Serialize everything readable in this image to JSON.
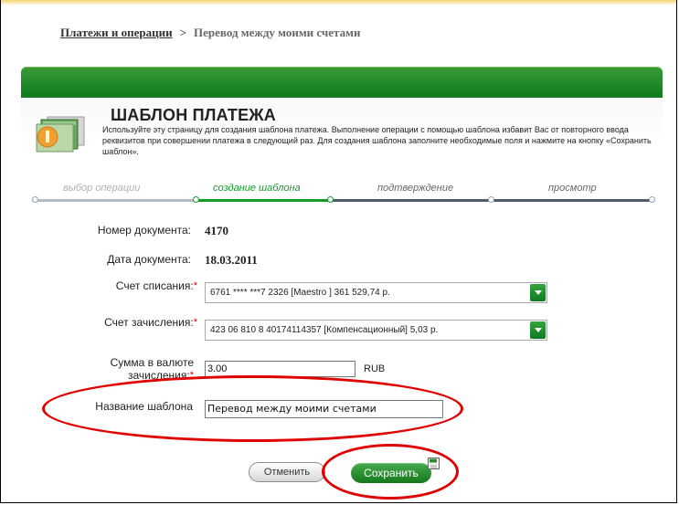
{
  "breadcrumb": {
    "link": "Платежи и операции",
    "current": "Перевод между моими счетами"
  },
  "page": {
    "title": "ШАБЛОН ПЛАТЕЖА",
    "description": "Используйте эту страницу для создания шаблона платежа. Выполнение операции с помощью шаблона избавит Вас от повторного ввода реквизитов при совершении платежа в следующий раз. Для создания шаблона заполните необходимые поля и нажмите на кнопку «Сохранить шаблон»."
  },
  "steps": [
    {
      "label": "выбор операции",
      "state": "completed"
    },
    {
      "label": "создание шаблона",
      "state": "active"
    },
    {
      "label": "подтверждение",
      "state": "pending"
    },
    {
      "label": "просмотр",
      "state": "pending"
    }
  ],
  "form": {
    "document_number_label": "Номер документа:",
    "document_number": "4170",
    "document_date_label": "Дата документа:",
    "document_date": "18.03.2011",
    "debit_account_label": "Счет списания:",
    "debit_account_value": "6761 **** ***7 2326   [Maestro ] 361 529,74   р.",
    "credit_account_label": "Счет зачисления:",
    "credit_account_value": "423 06 810 8 40174114357  [Компенсационный] 5,03  р.",
    "amount_label_line1": "Сумма в валюте",
    "amount_label_line2": "зачисления:",
    "amount_value": "3.00",
    "currency": "RUB",
    "template_name_label": "Название шаблона",
    "template_name_value": "Перевод между моими счетами",
    "required_mark": "*"
  },
  "buttons": {
    "cancel": "Отменить",
    "save": "Сохранить"
  },
  "colors": {
    "brand_green": "#1a8a2a",
    "annotation_red": "#e00000",
    "required_red": "#dd0000"
  },
  "icons": [
    "folder-icon",
    "chevron-down-icon",
    "floppy-disk-icon"
  ]
}
